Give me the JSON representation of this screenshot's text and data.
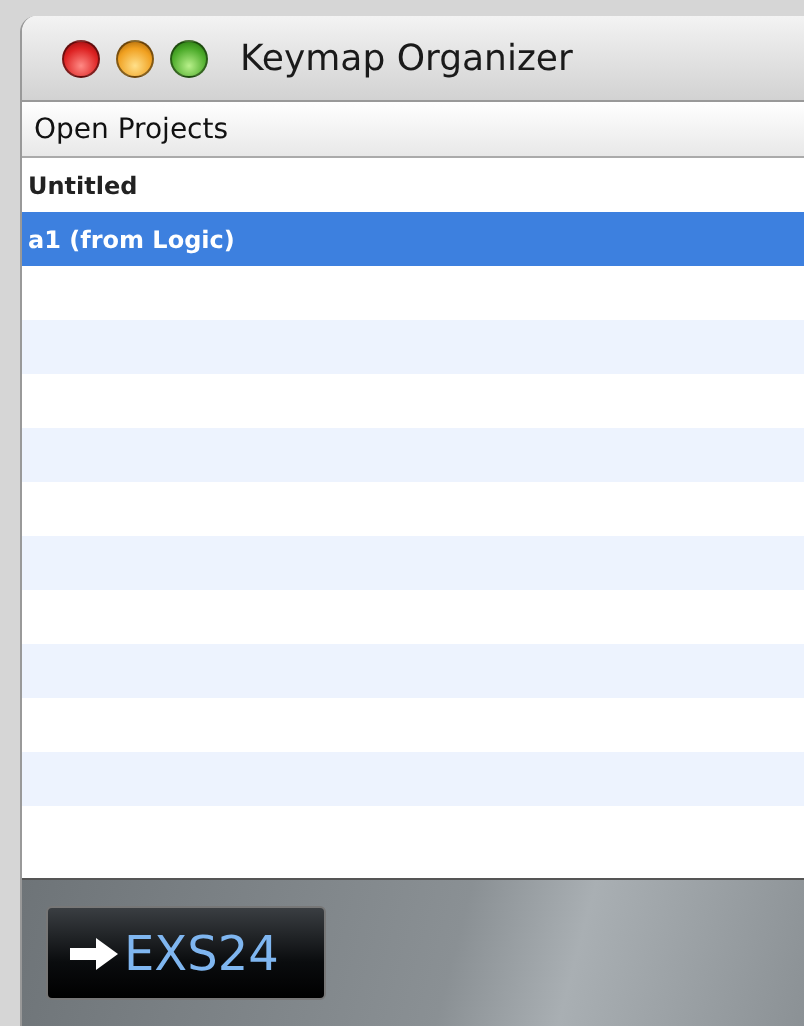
{
  "window": {
    "title": "Keymap Organizer"
  },
  "list": {
    "header": "Open Projects",
    "items": [
      {
        "label": "Untitled",
        "selected": false
      },
      {
        "label": "a1 (from Logic)",
        "selected": true
      }
    ]
  },
  "footer": {
    "button": "EXS24"
  }
}
